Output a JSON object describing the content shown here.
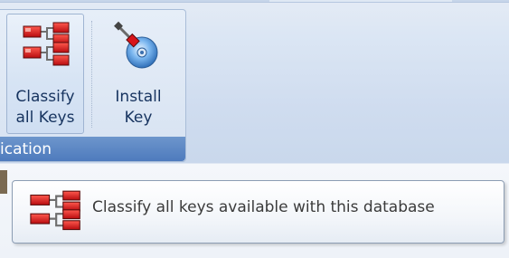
{
  "ribbon": {
    "group_caption": "ication",
    "buttons": [
      {
        "label_line1": "Classify",
        "label_line2": "all Keys",
        "icon": "classify-keys-icon"
      },
      {
        "label_line1": "Install",
        "label_line2": "Key",
        "icon": "install-key-icon"
      }
    ]
  },
  "tooltip": {
    "text": "Classify all keys available with this database",
    "icon": "classify-keys-icon"
  },
  "colors": {
    "group_caption_bg": "#5a86c4",
    "key_red": "#d8141a"
  }
}
